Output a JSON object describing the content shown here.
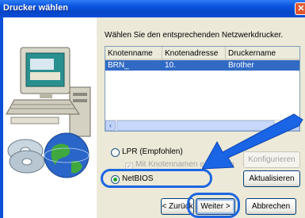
{
  "window": {
    "title": "Drucker wählen",
    "close_glyph": "✕"
  },
  "instruction": "Wählen Sie den entsprechenden Netzwerkdrucker.",
  "printer_list": {
    "columns": [
      "Knotenname",
      "Knotenadresse",
      "Druckername"
    ],
    "rows": [
      {
        "node_name": "BRN_",
        "node_address": "10.",
        "printer_name": "Brother",
        "selected": true
      }
    ],
    "scroll_left_glyph": "‹",
    "scroll_right_glyph": "›"
  },
  "options": {
    "lpr_label": "LPR (Empfohlen)",
    "lpr_selected": false,
    "node_name_checkbox_label": "Mit Knotennamen einrichten",
    "node_name_checkbox_checked": true,
    "netbios_label": "NetBIOS",
    "netbios_selected": true
  },
  "buttons": {
    "configure": "Konfigurieren",
    "refresh": "Aktualisieren",
    "back": "< Zurück",
    "next": "Weiter >",
    "cancel": "Abbrechen"
  },
  "colors": {
    "titlebar": "#0a55e0",
    "selection": "#316ac5",
    "annotation": "#1d66e0"
  },
  "icons": [
    "close-icon",
    "computer-icon",
    "globe-icon",
    "cd-icon",
    "callout-arrow-icon"
  ]
}
